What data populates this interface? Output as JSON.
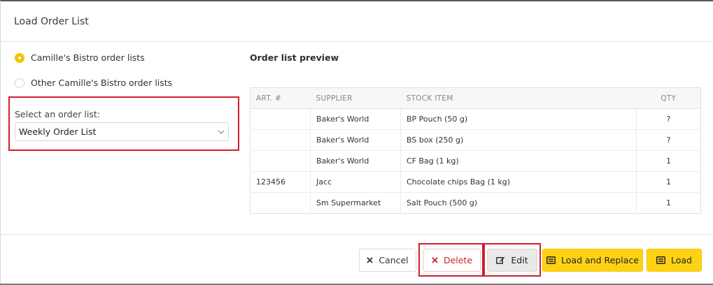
{
  "dialog": {
    "title": "Load Order List"
  },
  "source": {
    "options": [
      {
        "label": "Camille's Bistro order lists",
        "selected": true
      },
      {
        "label": "Other Camille's Bistro order lists",
        "selected": false
      }
    ]
  },
  "select": {
    "label": "Select an order list:",
    "value": "Weekly Order List"
  },
  "preview": {
    "title": "Order list preview",
    "columns": {
      "art": "ART. #",
      "supplier": "SUPPLIER",
      "item": "STOCK ITEM",
      "qty": "QTY"
    },
    "rows": [
      {
        "art": "",
        "supplier": "Baker's World",
        "item": "BP Pouch (50 g)",
        "qty": "?"
      },
      {
        "art": "",
        "supplier": "Baker's World",
        "item": "BS box (250 g)",
        "qty": "?"
      },
      {
        "art": "",
        "supplier": "Baker's World",
        "item": "CF Bag (1 kg)",
        "qty": "1"
      },
      {
        "art": "123456",
        "supplier": "Jacc",
        "item": "Chocolate chips Bag (1 kg)",
        "qty": "1"
      },
      {
        "art": "",
        "supplier": "Sm Supermarket",
        "item": "Salt Pouch (500 g)",
        "qty": "1"
      }
    ]
  },
  "footer": {
    "cancel": "Cancel",
    "delete": "Delete",
    "edit": "Edit",
    "load_replace": "Load and Replace",
    "load": "Load"
  },
  "colors": {
    "accent": "#fed214",
    "radio_selected": "#f5c400",
    "danger": "#d0202a",
    "highlight_frame": "#d0202a"
  }
}
